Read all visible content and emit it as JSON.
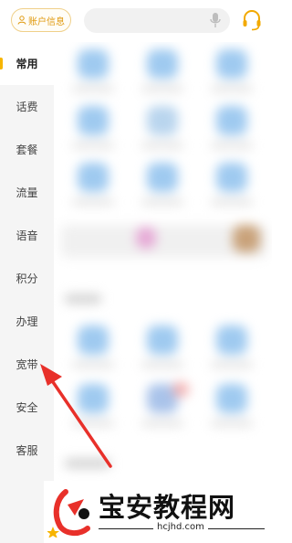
{
  "header": {
    "account_label": "账户信息",
    "search_placeholder": ""
  },
  "sidebar": {
    "items": [
      {
        "label": "常用",
        "active": true
      },
      {
        "label": "话费"
      },
      {
        "label": "套餐"
      },
      {
        "label": "流量"
      },
      {
        "label": "语音"
      },
      {
        "label": "积分"
      },
      {
        "label": "办理"
      },
      {
        "label": "宽带"
      },
      {
        "label": "安全"
      },
      {
        "label": "客服"
      }
    ]
  },
  "watermark": {
    "brand": "宝安教程网",
    "url": "hcjhd.com"
  },
  "colors": {
    "accent": "#f7b500",
    "arrow": "#e8302a",
    "sidebar_bg": "#f5f5f5"
  }
}
